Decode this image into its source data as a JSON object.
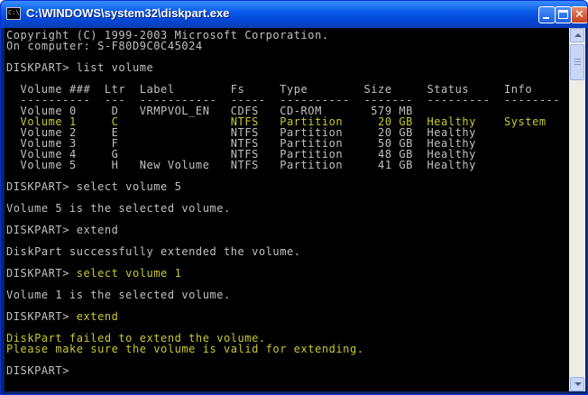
{
  "window": {
    "title": "C:\\WINDOWS\\system32\\diskpart.exe",
    "icon_text": "C:\\"
  },
  "console": {
    "lines": [
      {
        "text": "Copyright (C) 1999-2003 Microsoft Corporation.",
        "color": "#c0c0c0"
      },
      {
        "text": "On computer: S-F80D9C0C45024",
        "color": "#c0c0c0"
      },
      {
        "text": "",
        "color": "#c0c0c0"
      },
      {
        "text": "DISKPART> list volume",
        "color": "#c0c0c0"
      },
      {
        "text": "",
        "color": "#c0c0c0"
      },
      {
        "text": "  Volume ###  Ltr  Label        Fs     Type        Size     Status     Info",
        "color": "#c0c0c0"
      },
      {
        "text": "  ----------  ---  -----------  -----  ----------  -------  ---------  --------",
        "color": "#c0c0c0"
      },
      {
        "text": "  Volume 0     D   VRMPVOL_EN   CDFS   CD-ROM       579 MB",
        "color": "#c0c0c0"
      },
      {
        "text": "  Volume 1     C                NTFS   Partition     20 GB  Healthy    System",
        "color": "#c8c832"
      },
      {
        "text": "  Volume 2     E                NTFS   Partition     20 GB  Healthy",
        "color": "#c0c0c0"
      },
      {
        "text": "  Volume 3     F                NTFS   Partition     50 GB  Healthy",
        "color": "#c0c0c0"
      },
      {
        "text": "  Volume 4     G                NTFS   Partition     48 GB  Healthy",
        "color": "#c0c0c0"
      },
      {
        "text": "  Volume 5     H   New Volume   NTFS   Partition     41 GB  Healthy",
        "color": "#c0c0c0"
      },
      {
        "text": "",
        "color": "#c0c0c0"
      },
      {
        "text": "DISKPART> select volume 5",
        "color": "#c0c0c0"
      },
      {
        "text": "",
        "color": "#c0c0c0"
      },
      {
        "text": "Volume 5 is the selected volume.",
        "color": "#c0c0c0"
      },
      {
        "text": "",
        "color": "#c0c0c0"
      },
      {
        "text": "DISKPART> extend",
        "color": "#c0c0c0"
      },
      {
        "text": "",
        "color": "#c0c0c0"
      },
      {
        "text": "DiskPart successfully extended the volume.",
        "color": "#c0c0c0"
      },
      {
        "text": "",
        "color": "#c0c0c0"
      },
      {
        "prompt": "DISKPART> ",
        "command": "select volume 1",
        "color": "#c0c0c0",
        "command_color": "#c8c832"
      },
      {
        "text": "",
        "color": "#c0c0c0"
      },
      {
        "text": "Volume 1 is the selected volume.",
        "color": "#c0c0c0"
      },
      {
        "text": "",
        "color": "#c0c0c0"
      },
      {
        "prompt": "DISKPART> ",
        "command": "extend",
        "color": "#c0c0c0",
        "command_color": "#c8c832"
      },
      {
        "text": "",
        "color": "#c0c0c0"
      },
      {
        "text": "DiskPart failed to extend the volume.",
        "color": "#c8c832"
      },
      {
        "text": "Please make sure the volume is valid for extending.",
        "color": "#c8c832"
      },
      {
        "text": "",
        "color": "#c0c0c0"
      },
      {
        "text": "DISKPART>",
        "color": "#c0c0c0"
      }
    ]
  },
  "colors": {
    "console_bg": "#000000",
    "console_text": "#c0c0c0",
    "highlight_text": "#c8c832",
    "titlebar_blue": "#0a5bea"
  },
  "icons": [
    "console-app-icon",
    "minimize-icon",
    "maximize-icon",
    "close-icon",
    "scroll-up-arrow-icon",
    "scroll-down-arrow-icon"
  ]
}
